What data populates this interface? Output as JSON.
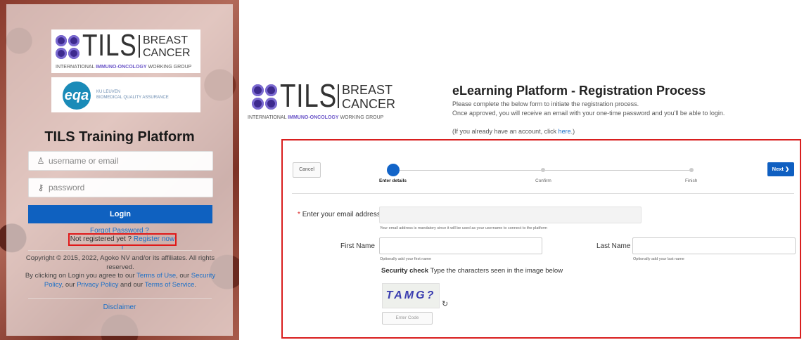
{
  "login": {
    "logo_tils": "TILS",
    "logo_breast": "BREAST",
    "logo_cancer": "CANCER",
    "logo_subtitle_pre": "INTERNATIONAL ",
    "logo_subtitle_hl": "IMMUNO-ONCOLOGY",
    "logo_subtitle_post": " WORKING GROUP",
    "eqa_logo": "eqa",
    "eqa_line1": "KU LEUVEN",
    "eqa_line2": "BIOMEDICAL QUALITY ASSURANCE",
    "title": "TILS Training Platform",
    "username_placeholder": "username or email",
    "password_placeholder": "password",
    "login_button": "Login",
    "forgot_password": "Forgot Password ?",
    "not_registered": "Not registered yet ?",
    "register_now": "Register now !",
    "copyright": "Copyright © 2015, 2022, Agoko NV and/or its affiliates. All rights reserved.",
    "terms_prefix": "By clicking on Login you agree to our",
    "terms_of_use": "Terms of Use",
    "our": ", our",
    "security_policy": "Security Policy",
    "our2": ", our",
    "privacy_policy": "Privacy Policy",
    "and_our": "and our",
    "terms_of_service": "Terms of Service",
    "period": ".",
    "disclaimer": "Disclaimer"
  },
  "registration": {
    "logo_tils": "TILS",
    "logo_breast": "BREAST",
    "logo_cancer": "CANCER",
    "logo_subtitle_pre": "INTERNATIONAL ",
    "logo_subtitle_hl": "IMMUNO-ONCOLOGY",
    "logo_subtitle_post": " WORKING GROUP",
    "title": "eLearning Platform - Registration Process",
    "subtitle1": "Please complete the below form to initiate the registration process.",
    "subtitle2": "Once approved, you will receive an email with your one-time password and you'll be able to login.",
    "account_prefix": "(If you already have an account, click ",
    "account_link": "here",
    "account_suffix": ".)",
    "cancel": "Cancel",
    "next": "Next",
    "steps": [
      "Enter details",
      "Confirm",
      "Finish"
    ],
    "email_label": "Enter your email address",
    "email_required_mark": "*",
    "email_hint": "Your email address is mandatory since it will be used as your username to connect to the platform",
    "first_name_label": "First Name",
    "first_name_hint": "Optionally add your first name",
    "last_name_label": "Last Name",
    "last_name_hint": "Optionally add your last name",
    "security_check_bold": "Security check",
    "security_check_text": " Type the characters seen in the image below",
    "captcha_text": "TAMG?",
    "code_placeholder": "Enter Code"
  },
  "colors": {
    "accent_blue": "#0f61c0",
    "highlight_red": "#d91f1f",
    "link_blue": "#1a6fc7"
  }
}
